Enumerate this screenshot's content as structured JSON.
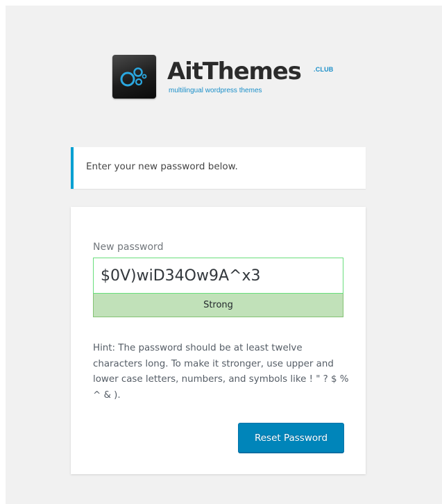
{
  "brand": {
    "name": "AitThemes",
    "suffix": ".CLUB",
    "tagline": "multilingual wordpress themes",
    "icon": "bubbles-logo-icon",
    "accent_color": "#1a8fc9"
  },
  "message": {
    "text": "Enter your new password below.",
    "border_color": "#00a0d2"
  },
  "form": {
    "password_label": "New password",
    "password_value": "$0V)wiD34Ow9A^x3",
    "strength_label": "Strong",
    "strength_color": "#c1e1b9",
    "hint": "Hint: The password should be at least twelve characters long. To make it stronger, use upper and lower case letters, numbers, and symbols like ! \" ? $ % ^ & ).",
    "submit_label": "Reset Password",
    "submit_color": "#0085ba"
  }
}
